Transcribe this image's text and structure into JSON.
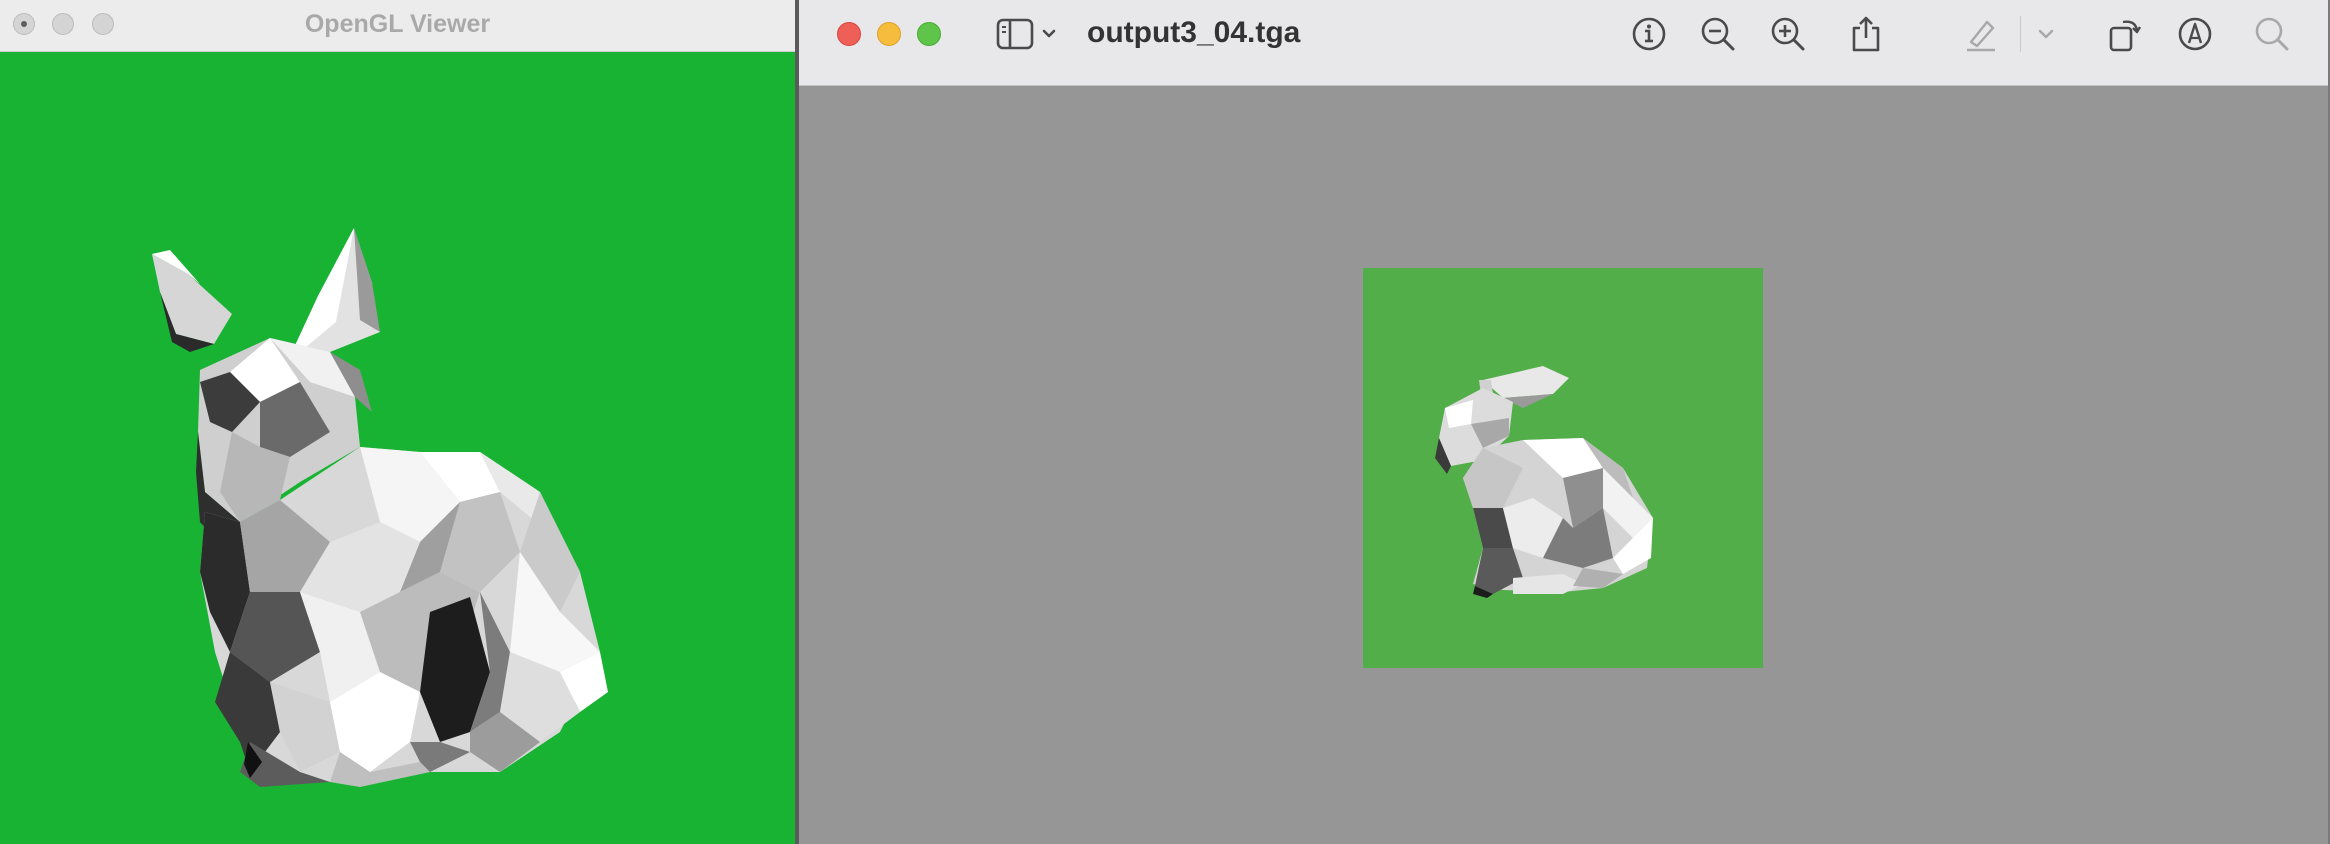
{
  "gl_viewer": {
    "title": "OpenGL Viewer",
    "background_color": "#19b334"
  },
  "preview": {
    "filename": "output3_04.tga",
    "background_color": "#969696",
    "image_background_color": "#52ae48",
    "toolbar": {
      "sidebar_toggle": "sidebar-icon",
      "info": "info-icon",
      "zoom_out": "zoom-out-icon",
      "zoom_in": "zoom-in-icon",
      "share": "share-icon",
      "highlight": "pen-icon",
      "rotate": "rotate-icon",
      "markup": "markup-icon",
      "search": "search-icon"
    }
  }
}
